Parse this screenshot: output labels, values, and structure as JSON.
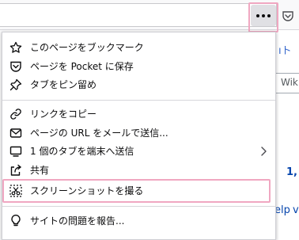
{
  "page": {
    "frag_1": "ıト",
    "frag_2": "Wiki",
    "frag_3": "1,",
    "frag_4": "elp",
    "frag_5": "v"
  },
  "menu": {
    "items": [
      {
        "label": "このページをブックマーク",
        "icon": "star-icon"
      },
      {
        "label": "ページを Pocket に保存",
        "icon": "pocket-icon"
      },
      {
        "label": "タブをピン留め",
        "icon": "pin-icon"
      },
      {
        "label": "リンクをコピー",
        "icon": "link-icon"
      },
      {
        "label": "ページの URL をメールで送信...",
        "icon": "mail-icon"
      },
      {
        "label": "1 個のタブを端末へ送信",
        "icon": "send-device-icon"
      },
      {
        "label": "共有",
        "icon": "share-icon"
      },
      {
        "label": "スクリーンショットを撮る",
        "icon": "screenshot-icon"
      },
      {
        "label": "サイトの問題を報告...",
        "icon": "lightbulb-icon"
      }
    ]
  }
}
